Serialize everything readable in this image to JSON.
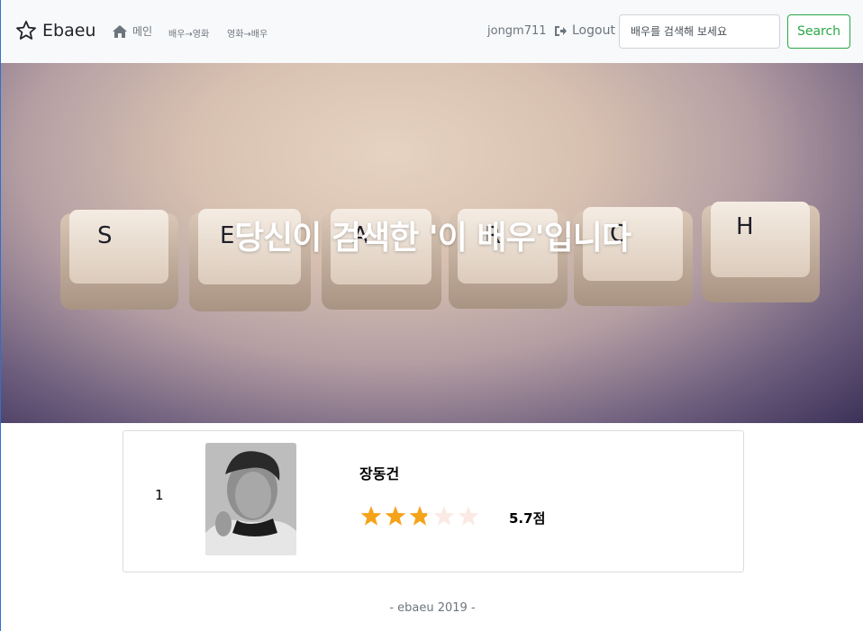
{
  "navbar": {
    "brand": "Ebaeu",
    "home_label": "메인",
    "link_actor_to_movie": "배우→영화",
    "link_movie_to_actor": "영화→배우",
    "username": "jongm711",
    "logout_label": "Logout",
    "search_placeholder": "배우를 검색해 보세요",
    "search_button": "Search",
    "icons": {
      "brand": "star-outline-icon",
      "home": "home-icon",
      "logout": "sign-out-icon"
    }
  },
  "hero": {
    "title": "당신이 검색한 '이 배우'입니다",
    "key_letters": [
      "S",
      "E",
      "A",
      "R",
      "C",
      "H"
    ]
  },
  "results": [
    {
      "rank": "1",
      "name": "장동건",
      "rating": 5.7,
      "rating_max": 10,
      "score_text": "5.7점"
    }
  ],
  "footer": {
    "text": "- ebaeu 2019 -"
  },
  "colors": {
    "accent_green": "#28a745",
    "star_fill": "#f5a31a",
    "star_empty": "#fbe9e4",
    "navbar_bg": "#f8f9fa"
  }
}
